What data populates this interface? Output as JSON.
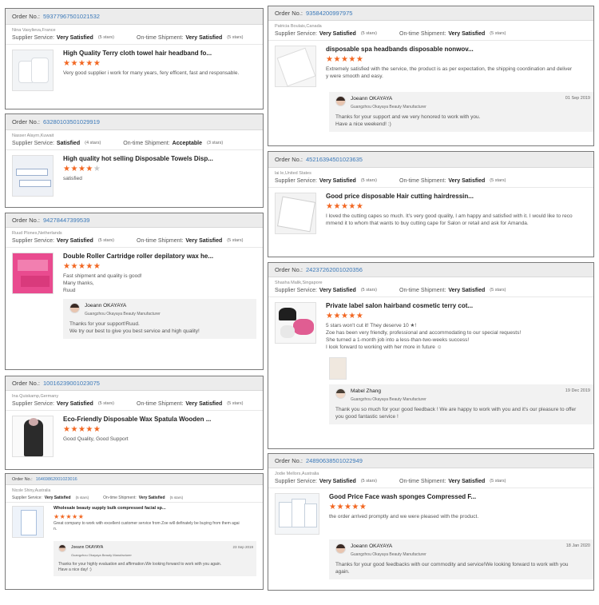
{
  "order_label": "Order No.:",
  "supplier_label": "Supplier Service:",
  "shipment_label": "On-time Shipment:",
  "reviews": [
    {
      "order": "59377967501021532",
      "customer": "Nina Vasylieva,France",
      "supplier": "Very Satisfied",
      "supplier_stars": "(5 stars)",
      "shipment": "Very Satisfied",
      "shipment_stars": "(5 stars)",
      "product": "High Quality Terry cloth towel hair headband fo...",
      "rating": 5,
      "comment": "Very good supplier i work for many years, fery efficent, fast and responsable."
    },
    {
      "order": "63280103501029919",
      "customer": "Nasser Alayrn,Kuwait",
      "supplier": "Satisfied",
      "supplier_stars": "(4 stars)",
      "shipment": "Acceptable",
      "shipment_stars": "(3 stars)",
      "product": "High quality hot selling Disposable Towels Disp...",
      "rating": 4,
      "comment": "satisfied"
    },
    {
      "order": "94278447399539",
      "customer": "Ruud Plones,Netherlands",
      "supplier": "Very Satisfied",
      "supplier_stars": "(5 stars)",
      "shipment": "Very Satisfied",
      "shipment_stars": "(5 stars)",
      "product": "Double Roller Cartridge roller depilatory wax he...",
      "rating": 5,
      "comment": "Fast shipment and quality is good!\nMany thanks,\nRuud",
      "reply": {
        "name": "Joeann OKAYAYA",
        "company": "Guangzhou Okayaya Beauty Manufacturer",
        "date": "",
        "text": "Thanks for your support!Ruud.\nWe try our best to give you best service and high quality!"
      }
    },
    {
      "order": "10016239001023075",
      "customer": "Ina Quiskamp,Germany",
      "supplier": "Very Satisfied",
      "supplier_stars": "(5 stars)",
      "shipment": "Very Satisfied",
      "shipment_stars": "(5 stars)",
      "product": "Eco-Friendly Disposable Wax Spatula Wooden ...",
      "rating": 5,
      "comment": "Good Quality, Good Support"
    },
    {
      "order": "16469862001023016",
      "customer": "Nicole Shiny,Australia",
      "supplier": "Very Satisfied",
      "supplier_stars": "(5 stars)",
      "shipment": "Very Satisfied",
      "shipment_stars": "(5 stars)",
      "product": "Wholesale beauty supply bulk compressed facial sp...",
      "rating": 5,
      "comment": "Great company to work with excellent customer service from Zoe will definately be buying from them agai\nn.",
      "reply": {
        "name": "Joeann OKAYAYA",
        "company": "Guangzhou Okayaya Beauty Manufacturer",
        "date": "23 Sep 2019",
        "text": "Thanks for your highly evaluation and affirmation.We looking forward to work with you again.\nHave a nice day! :)"
      }
    },
    {
      "order": "93584200997975",
      "customer": "Patricia Boulais,Canada",
      "supplier": "Very Satisfied",
      "supplier_stars": "(5 stars)",
      "shipment": "Very Satisfied",
      "shipment_stars": "(5 stars)",
      "product": "disposable spa headbands disposable nonwov...",
      "rating": 5,
      "comment": "Extremely satisfied with the service, the product is as per expectation, the shipping coordination and deliver\ny were smooth and easy.",
      "reply": {
        "name": "Joeann OKAYAYA",
        "company": "Guangzhou Okayaya Beauty Manufacturer",
        "date": "01 Sep 2019",
        "text": "Thanks for your support and we very honored to work with you.\nHave a nice weekend! :)"
      }
    },
    {
      "order": "45216394501023635",
      "customer": "lai le,United States",
      "supplier": "Very Satisfied",
      "supplier_stars": "(5 stars)",
      "shipment": "Very Satisfied",
      "shipment_stars": "(5 stars)",
      "product": "Good price disposable Hair cutting hairdressin...",
      "rating": 5,
      "comment": "I loved the cutting capes so much. It's very good quality, I am happy and satisfied with it. I would like to reco\nmmend it to whom that wants to buy cutting cape for Salon or retail and ask for Amanda."
    },
    {
      "order": "24237262001020356",
      "customer": "Shasha Malik,Singapore",
      "supplier": "Very Satisfied",
      "supplier_stars": "(5 stars)",
      "shipment": "Very Satisfied",
      "shipment_stars": "(5 stars)",
      "product": "Private label salon hairband cosmetic terry cot...",
      "rating": 5,
      "comment": "5 stars won't cut it! They deserve 10 ★!\nZoe has been very friendly, professional and accommodating to our special requests!\nShe turned a 1-month job into a less-than-two-weeks success!\nI look forward  to working with her more in future ☺",
      "reply": {
        "name": "Mabel Zhang",
        "company": "Guangzhou Okayaya Beauty Manufacturer",
        "date": "19 Dec 2019",
        "text": "Thank you so much for your good feedback ! We are happy to work with you and it's our pleasure to offer\nyou good fantastic service !"
      }
    },
    {
      "order": "24890638501022949",
      "customer": "Jodie Mellors,Australia",
      "supplier": "Very Satisfied",
      "supplier_stars": "(5 stars)",
      "shipment": "Very Satisfied",
      "shipment_stars": "(5 stars)",
      "product": "Good Price Face wash sponges Compressed F...",
      "rating": 5,
      "comment": "the order arrived promptly and we were pleased with the product.",
      "reply": {
        "name": "Joeann OKAYAYA",
        "company": "Guangzhou Okayaya Beauty Manufacturer",
        "date": "18 Jan 2020",
        "text": "Thanks for your good feedbacks with our commodity and service!We looking forward to work with you\nagain."
      }
    }
  ]
}
